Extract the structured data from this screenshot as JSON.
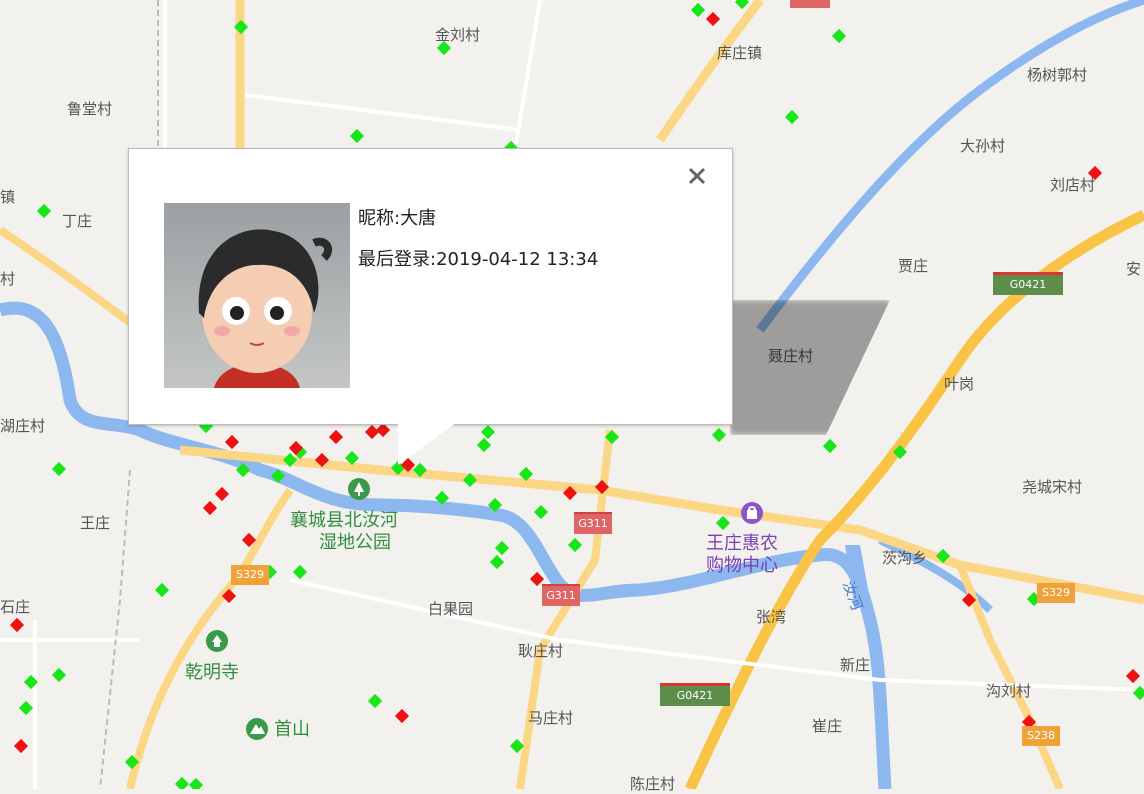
{
  "popup": {
    "nickname_label": "昵称:大唐",
    "last_login_label": "最后登录:2019-04-12 13:34",
    "close_glyph": "×"
  },
  "places": {
    "jinliu": "金刘村",
    "kuzhuang": "库庄镇",
    "yangshu": "杨树郭村",
    "lutang": "鲁堂村",
    "dasun": "大孙村",
    "liudian": "刘店村",
    "jiazhuang": "贾庄",
    "an": "安",
    "ding": "丁庄",
    "zhen": "镇",
    "cun_left": "村",
    "niezhuang": "聂庄村",
    "yegang": "叶岗",
    "hu": "湖庄村",
    "yaocheng": "尧城宋村",
    "wangzhuang": "王庄",
    "shizhuang": "石庄",
    "baiguo": "白果园",
    "gengzhuang": "耿庄村",
    "zhangwan": "张湾",
    "xinzhuang": "新庄",
    "goulicun": "沟刘村",
    "cuizhuang": "崔庄",
    "mazhuang": "马庄村",
    "chenzhuang": "陈庄村",
    "rugou": "茨沟乡",
    "ruhe": "汝河"
  },
  "pois": {
    "park_line1": "襄城县北汝河",
    "park_line2": "湿地公园",
    "temple": "乾明寺",
    "shoushan": "首山",
    "shop_line1": "王庄惠农",
    "shop_line2": "购物中心"
  },
  "shields": {
    "g0421_a": "G0421",
    "g0421_b": "G0421",
    "g311_a": "G311",
    "g311_b": "G311",
    "s329_a": "S329",
    "s329_b": "S329",
    "s238": "S238"
  },
  "colors": {
    "green_marker": "#19e619",
    "red_marker": "#ee1111",
    "road_yellow": "#fbd684",
    "expressway": "#f9c446",
    "river": "#8cb8ef"
  },
  "legend_markers": {
    "online_color": "green",
    "offline_color": "red"
  }
}
